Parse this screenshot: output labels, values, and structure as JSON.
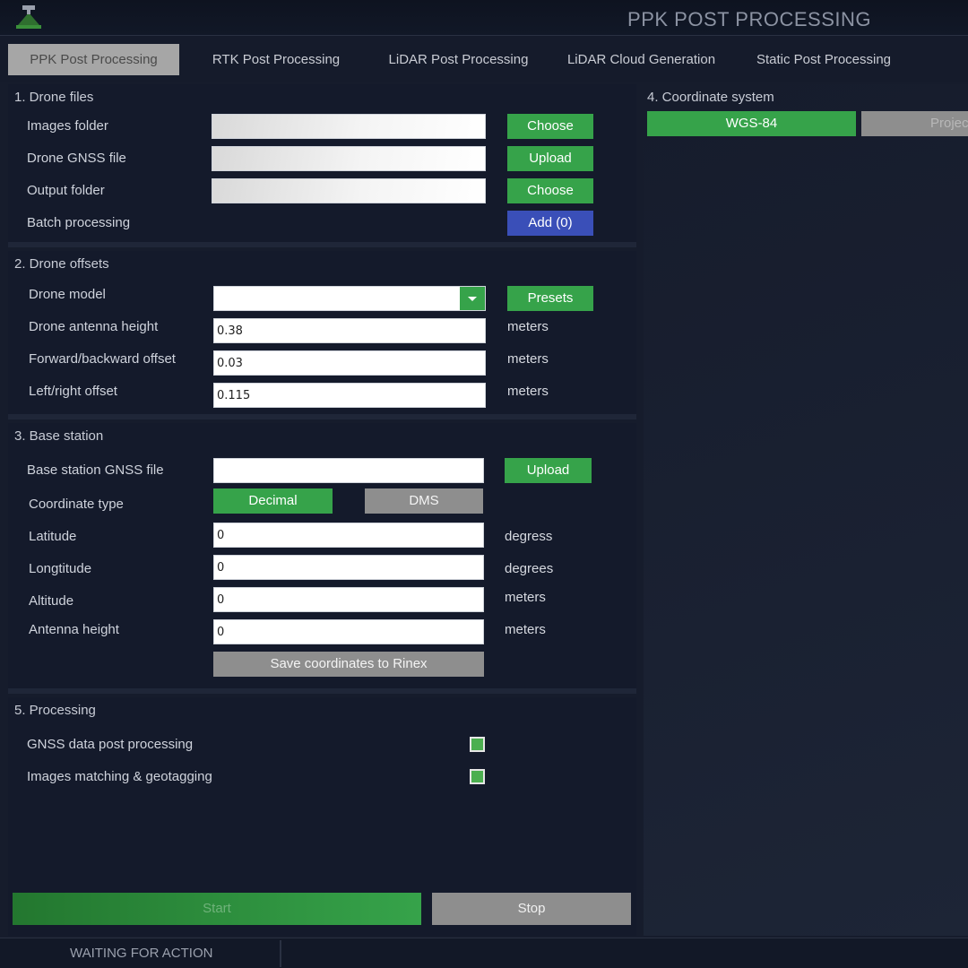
{
  "window": {
    "title": "PPK POST PROCESSING"
  },
  "tabs": [
    {
      "label": "PPK Post Processing",
      "active": true
    },
    {
      "label": "RTK Post Processing",
      "active": false
    },
    {
      "label": "LiDAR Post Processing",
      "active": false
    },
    {
      "label": "LiDAR Cloud Generation",
      "active": false
    },
    {
      "label": "Static Post Processing",
      "active": false
    }
  ],
  "drone_files": {
    "title": "1. Drone files",
    "images_folder": {
      "label": "Images folder",
      "value": "",
      "button": "Choose"
    },
    "drone_gnss": {
      "label": "Drone GNSS file",
      "value": "",
      "button": "Upload"
    },
    "output_folder": {
      "label": "Output folder",
      "value": "",
      "button": "Choose"
    },
    "batch": {
      "label": "Batch processing",
      "button": "Add (0)"
    }
  },
  "drone_offsets": {
    "title": "2. Drone offsets",
    "model": {
      "label": "Drone model",
      "value": "",
      "button": "Presets"
    },
    "antenna_height": {
      "label": "Drone antenna height",
      "value": "0.38",
      "unit": "meters"
    },
    "forward_offset": {
      "label": "Forward/backward offset",
      "value": "0.03",
      "unit": "meters"
    },
    "lateral_offset": {
      "label": "Left/right offset",
      "value": "0.115",
      "unit": "meters"
    }
  },
  "base_station": {
    "title": "3. Base station",
    "gnss_file": {
      "label": "Base station GNSS file",
      "value": "",
      "button": "Upload"
    },
    "coord_type": {
      "label": "Coordinate type",
      "option_decimal": "Decimal",
      "option_dms": "DMS",
      "selected": "Decimal"
    },
    "latitude": {
      "label": "Latitude",
      "value": "0",
      "unit": "degress"
    },
    "longitude": {
      "label": "Longtitude",
      "value": "0",
      "unit": "degrees"
    },
    "altitude": {
      "label": "Altitude",
      "value": "0",
      "unit": "meters"
    },
    "antenna_height": {
      "label": "Antenna height",
      "value": "0",
      "unit": "meters"
    },
    "save_button": "Save coordinates to Rinex"
  },
  "coordinate_system": {
    "title": "4. Coordinate system",
    "option_wgs": "WGS-84",
    "option_projected": "Projec",
    "selected": "WGS-84"
  },
  "processing": {
    "title": "5. Processing",
    "gnss_post": {
      "label": "GNSS data post processing",
      "checked": true
    },
    "image_matching": {
      "label": "Images matching & geotagging",
      "checked": true
    }
  },
  "actions": {
    "start": "Start",
    "stop": "Stop"
  },
  "status": {
    "text": "WAITING FOR ACTION"
  },
  "colors": {
    "background": "#161c2c",
    "accent_green": "#36a34a",
    "accent_blue": "#3a4fb8",
    "neutral_grey": "#8e8e8e"
  }
}
